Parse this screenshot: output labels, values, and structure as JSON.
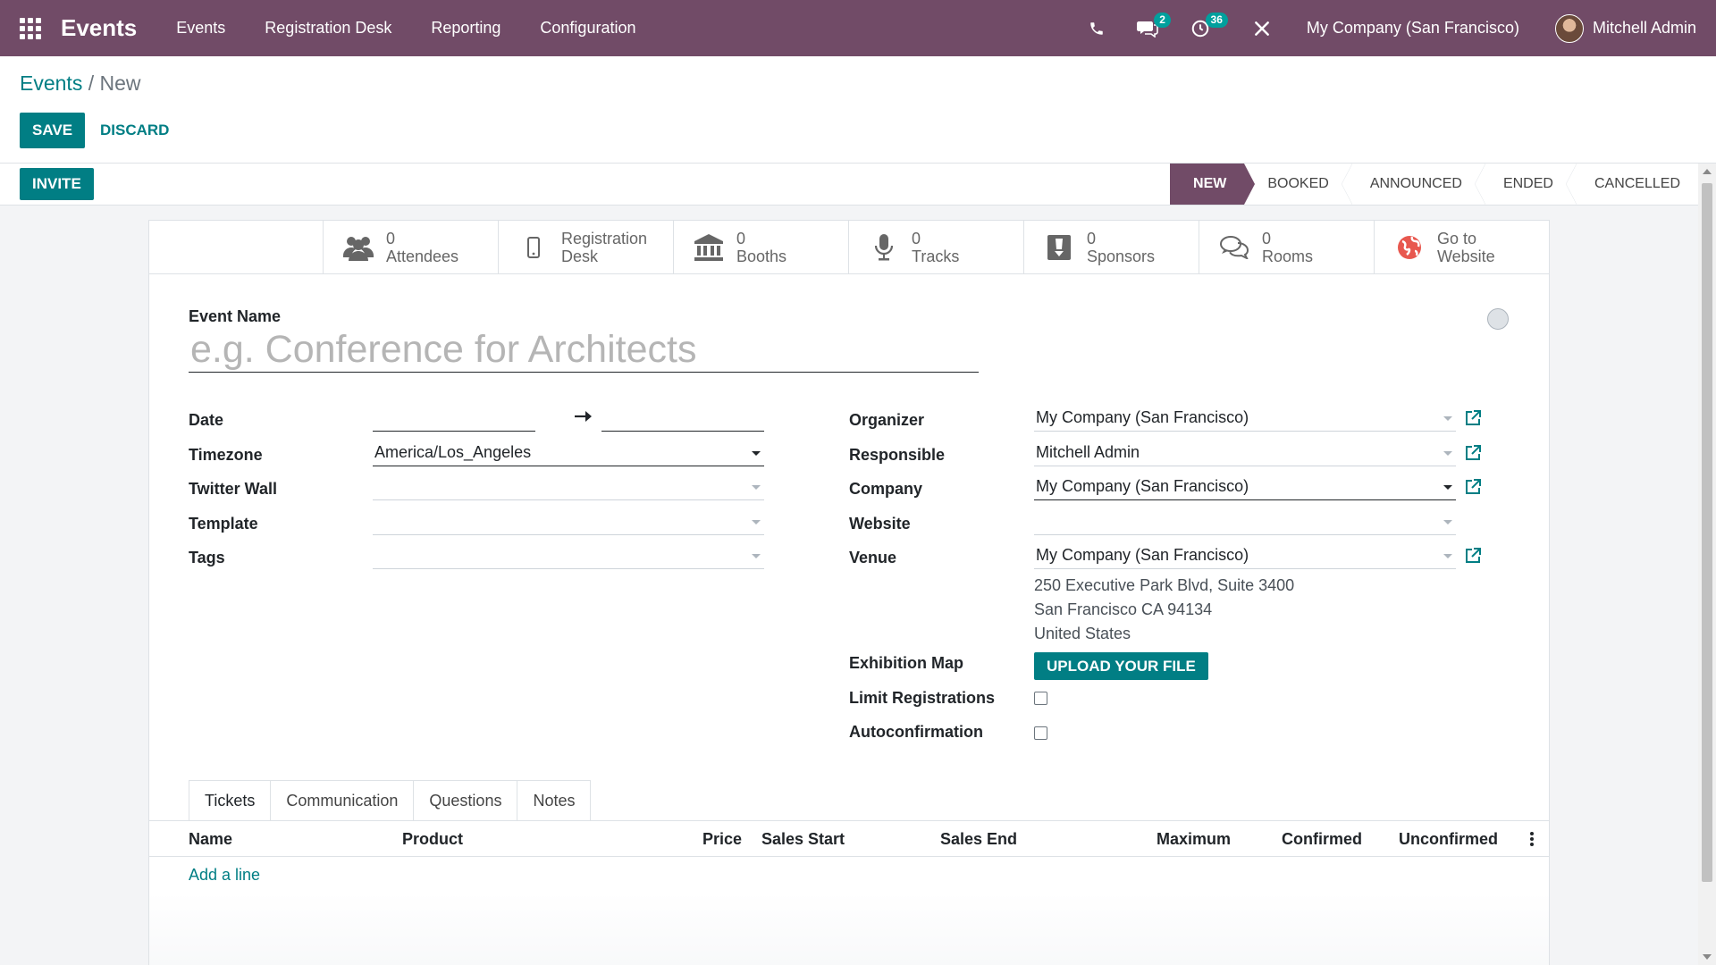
{
  "navbar": {
    "app_name": "Events",
    "menu": [
      "Events",
      "Registration Desk",
      "Reporting",
      "Configuration"
    ],
    "messages_count": "2",
    "activities_count": "36",
    "company": "My Company (San Francisco)",
    "user_name": "Mitchell Admin"
  },
  "breadcrumb": {
    "parent": "Events",
    "separator": "/",
    "current": "New"
  },
  "actions": {
    "save": "SAVE",
    "discard": "DISCARD",
    "invite": "INVITE"
  },
  "stages": [
    "NEW",
    "BOOKED",
    "ANNOUNCED",
    "ENDED",
    "CANCELLED"
  ],
  "active_stage": "NEW",
  "smart_buttons": {
    "attendees": {
      "count": "0",
      "label": "Attendees"
    },
    "registration_desk": {
      "line1": "Registration",
      "line2": "Desk"
    },
    "booths": {
      "count": "0",
      "label": "Booths"
    },
    "tracks": {
      "count": "0",
      "label": "Tracks"
    },
    "sponsors": {
      "count": "0",
      "label": "Sponsors"
    },
    "rooms": {
      "count": "0",
      "label": "Rooms"
    },
    "website": {
      "line1": "Go to",
      "line2": "Website"
    }
  },
  "form": {
    "event_name_label": "Event Name",
    "event_name_placeholder": "e.g. Conference for Architects",
    "left": {
      "date_label": "Date",
      "timezone_label": "Timezone",
      "timezone_value": "America/Los_Angeles",
      "twitter_wall_label": "Twitter Wall",
      "template_label": "Template",
      "tags_label": "Tags"
    },
    "right": {
      "organizer_label": "Organizer",
      "organizer_value": "My Company (San Francisco)",
      "responsible_label": "Responsible",
      "responsible_value": "Mitchell Admin",
      "company_label": "Company",
      "company_value": "My Company (San Francisco)",
      "website_label": "Website",
      "venue_label": "Venue",
      "venue_value": "My Company (San Francisco)",
      "venue_address": [
        "250 Executive Park Blvd, Suite 3400",
        "San Francisco CA 94134",
        "United States"
      ],
      "exhibition_map_label": "Exhibition Map",
      "upload_label": "UPLOAD YOUR FILE",
      "limit_registrations_label": "Limit Registrations",
      "autoconfirmation_label": "Autoconfirmation"
    }
  },
  "notebook": {
    "tabs": [
      "Tickets",
      "Communication",
      "Questions",
      "Notes"
    ],
    "active_tab": "Tickets",
    "columns": [
      "Name",
      "Product",
      "Price",
      "Sales Start",
      "Sales End",
      "Maximum",
      "Confirmed",
      "Unconfirmed"
    ],
    "add_line": "Add a line"
  },
  "colors": {
    "brand": "#714b67",
    "accent": "#017e84",
    "badge": "#00a09d"
  }
}
